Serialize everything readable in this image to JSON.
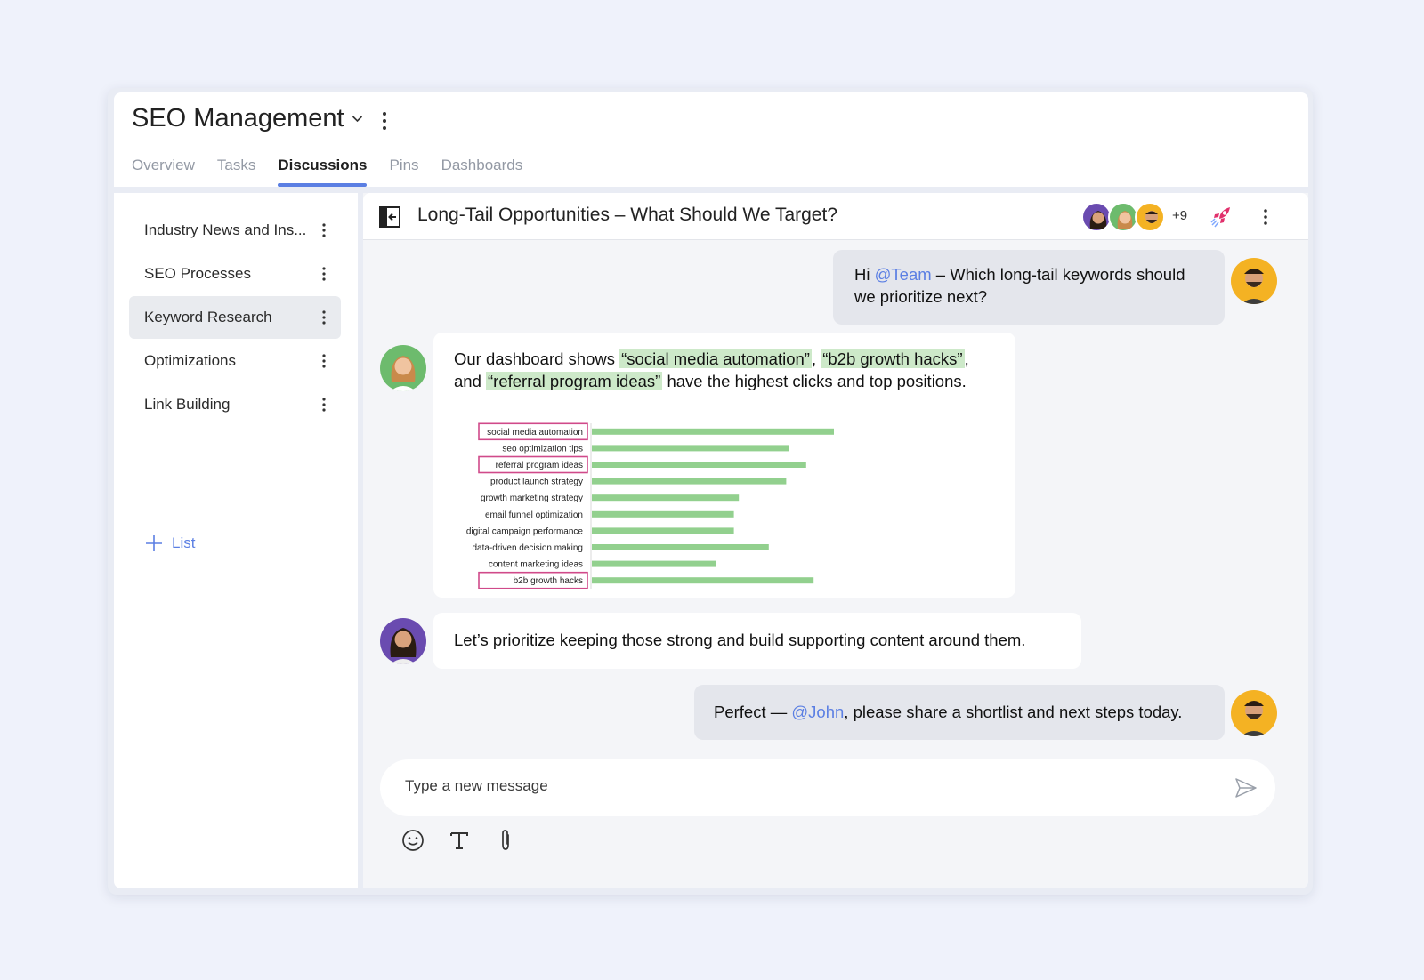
{
  "project": {
    "title": "SEO Management"
  },
  "tabs": [
    {
      "label": "Overview",
      "active": false
    },
    {
      "label": "Tasks",
      "active": false
    },
    {
      "label": "Discussions",
      "active": true
    },
    {
      "label": "Pins",
      "active": false
    },
    {
      "label": "Dashboards",
      "active": false
    }
  ],
  "sidebar": {
    "items": [
      {
        "label": "Industry News and Ins..."
      },
      {
        "label": "SEO Processes"
      },
      {
        "label": "Keyword Research",
        "active": true
      },
      {
        "label": "Optimizations"
      },
      {
        "label": "Link Building"
      }
    ],
    "add_label": "List"
  },
  "chat": {
    "title": "Long-Tail Opportunities – What Should We Target?",
    "members_more": "+9",
    "messages": {
      "m1": {
        "pre": "Hi ",
        "mention": "@Team",
        "post": " – Which long-tail keywords should we prioritize next?"
      },
      "m2": {
        "t1": "Our dashboard shows ",
        "h1": "“social media automation”",
        "t2": ", ",
        "h2": "“b2b growth hacks”",
        "t3": ", and ",
        "h3": "“referral program ideas”",
        "t4": " have the highest clicks and top positions."
      },
      "m3": {
        "text": "Let’s prioritize keeping those strong and build supporting content around them."
      },
      "m4": {
        "pre": "Perfect — ",
        "mention": "@John",
        "post": ", please share a shortlist and next steps today."
      }
    },
    "composer": {
      "placeholder": "Type a new message"
    }
  },
  "chart_data": {
    "type": "bar",
    "orientation": "horizontal",
    "categories": [
      "social media automation",
      "seo optimization tips",
      "referral program ideas",
      "product launch strategy",
      "growth marketing strategy",
      "email funnel optimization",
      "digital campaign performance",
      "data-driven decision making",
      "content marketing ideas",
      "b2b growth hacks"
    ],
    "values": [
      100,
      79,
      86,
      78,
      59,
      57,
      57,
      71,
      50,
      89
    ],
    "highlighted": [
      "social media automation",
      "referral program ideas",
      "b2b growth hacks"
    ],
    "bar_color": "#92d08e",
    "highlight_color": "#d04a8a",
    "title": "",
    "xlabel": "",
    "ylabel": ""
  },
  "colors": {
    "accent": "#5b7fe3",
    "highlight_bg": "#cde9c9"
  }
}
